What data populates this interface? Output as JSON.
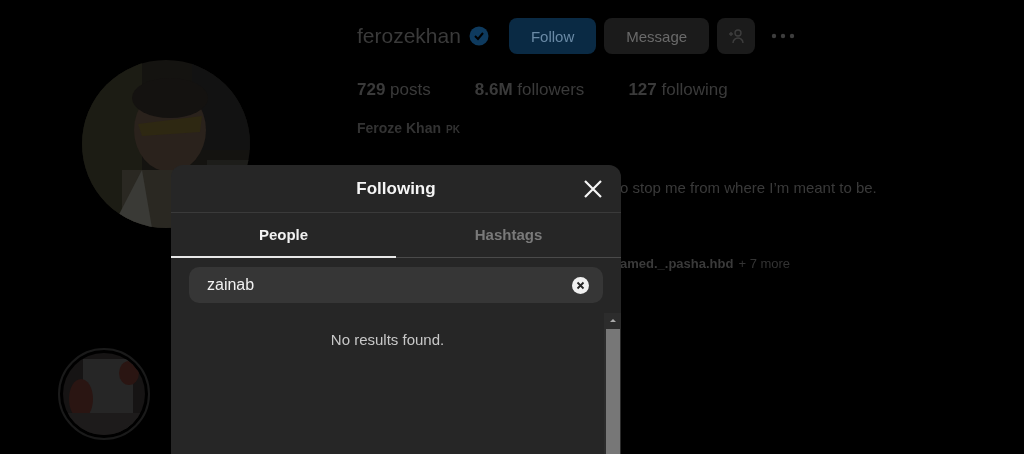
{
  "profile": {
    "username": "ferozekhan",
    "verified": true,
    "buttons": [
      {
        "label": "Follow",
        "kind": "primary"
      },
      {
        "label": "Message",
        "kind": "secondary"
      }
    ],
    "stats": [
      {
        "value": "729",
        "label": "posts"
      },
      {
        "value": "8.6M",
        "label": "followers"
      },
      {
        "value": "127",
        "label": "following"
      }
    ],
    "name": "Feroze Khan",
    "name_badge": "PK",
    "bio_visible": "o stop me from where I’m meant to be.",
    "followed_by": {
      "names": "amed._.pasha.hbd",
      "more": "+ 7 more"
    }
  },
  "dialog": {
    "title": "Following",
    "tabs": [
      {
        "label": "People",
        "selected": true
      },
      {
        "label": "Hashtags",
        "selected": false
      }
    ],
    "search": {
      "value": "zainab"
    },
    "empty_message": "No results found."
  }
}
